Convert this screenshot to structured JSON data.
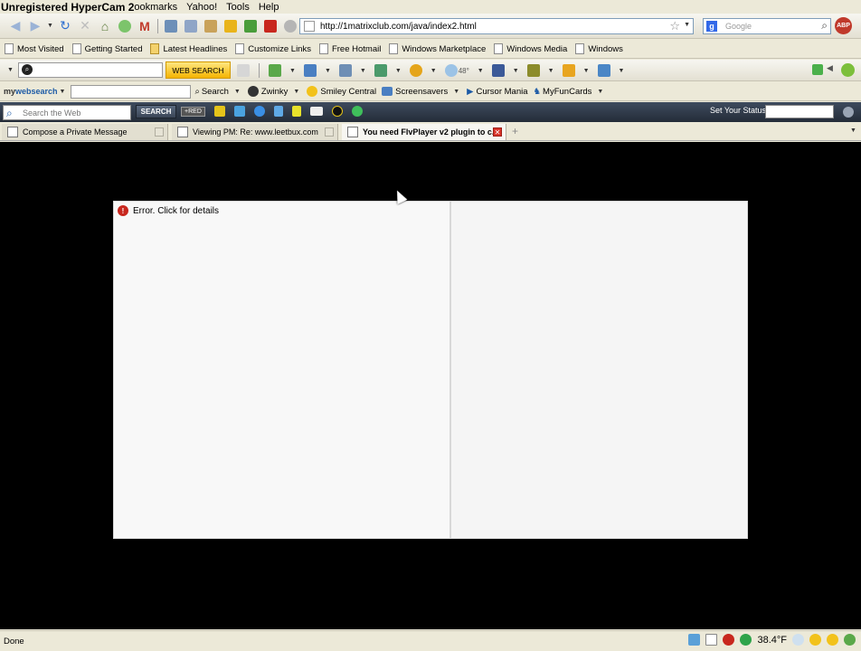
{
  "window": {
    "title": "Unregistered HyperCam 2"
  },
  "menu": {
    "items": [
      "Bookmarks",
      "Yahoo!",
      "Tools",
      "Help"
    ],
    "bookmarks_partial": "ookmarks"
  },
  "nav": {
    "url": "http://1matrixclub.com/java/index2.html",
    "search_placeholder": "Google",
    "abp_label": "ABP"
  },
  "bookmarks": {
    "items": [
      "Most Visited",
      "Getting Started",
      "Latest Headlines",
      "Customize Links",
      "Free Hotmail",
      "Windows Marketplace",
      "Windows Media",
      "Windows"
    ]
  },
  "toolbar3": {
    "websearch_label": "WEB SEARCH",
    "weather_badge": "48°"
  },
  "toolbar4": {
    "logo_prefix": "my",
    "logo_main": "websearch",
    "search_label": "Search",
    "items": [
      "Zwinky",
      "Smiley Central",
      "Screensavers",
      "Cursor Mania",
      "MyFunCards"
    ]
  },
  "toolbar5": {
    "search_placeholder": "Search the Web",
    "search_button": "SEARCH",
    "red_label": "RED",
    "status_label": "Set Your Status:"
  },
  "tabs": [
    {
      "label": "Compose a Private Message",
      "active": false
    },
    {
      "label": "Viewing PM: Re: www.leetbux.com",
      "active": false
    },
    {
      "label": "You need FlvPlayer v2 plugin to c...",
      "active": true
    }
  ],
  "content": {
    "error_text": "Error.  Click for details"
  },
  "status": {
    "text": "Done",
    "temperature": "38.4°F"
  },
  "colors": {
    "content_bg": "#000000",
    "error_red": "#c8271e",
    "websearch_yellow": "#f5b400",
    "dark_toolbar": "#2f3948"
  }
}
